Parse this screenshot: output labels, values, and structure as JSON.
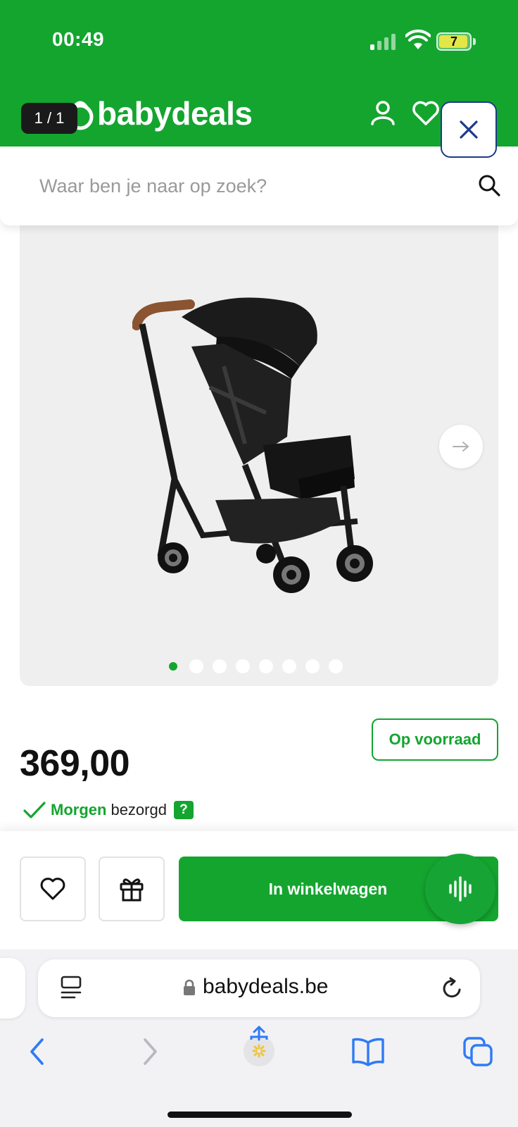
{
  "status_bar": {
    "time": "00:49",
    "battery": "7"
  },
  "header": {
    "image_counter": "1 / 1",
    "logo": "babydeals",
    "icons": [
      "user-icon",
      "heart-icon",
      "close-icon"
    ],
    "brand_color": "#14a52f"
  },
  "search": {
    "placeholder": "Waar ben je naar op zoek?",
    "value": ""
  },
  "gallery": {
    "slide_count": 8,
    "active_slide": 1,
    "image": "black-stroller"
  },
  "product": {
    "stock": "Op voorraad",
    "price": "369,00",
    "delivery_day": "Morgen",
    "delivery_text": "bezorgd",
    "help_badge": "?"
  },
  "actions": {
    "cart_label": "In winkelwagen",
    "icons": [
      "heart-icon",
      "gift-icon",
      "voice-icon"
    ]
  },
  "browser": {
    "url": "babydeals.be",
    "icons": [
      "reader-icon",
      "lock-icon",
      "reload-icon",
      "back-icon",
      "forward-icon",
      "share-icon",
      "bookmarks-icon",
      "tabs-icon"
    ]
  }
}
